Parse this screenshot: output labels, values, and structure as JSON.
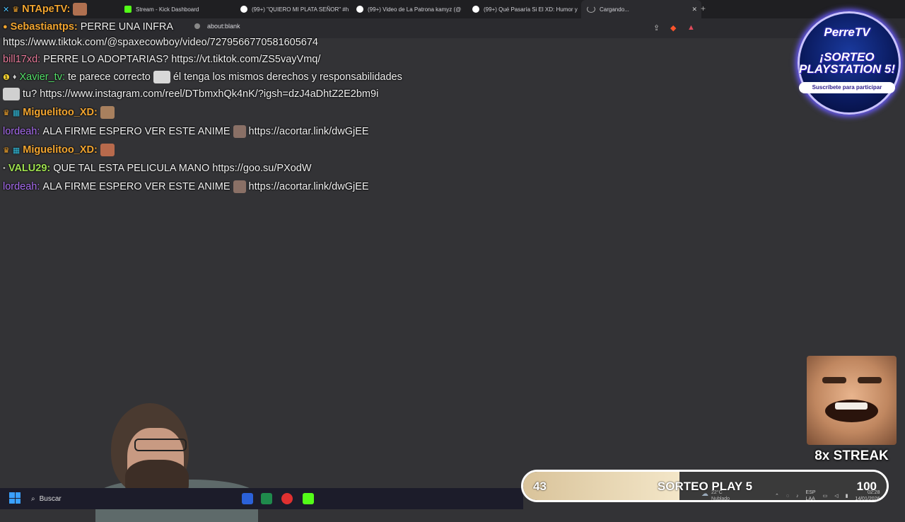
{
  "browser": {
    "tabs": [
      {
        "title": "Stream - Kick Dashboard",
        "color": "#53fc18"
      },
      {
        "title": "(99+) \"QUIERO MI PLATA SEÑOR\" #h",
        "color": "#ffffff"
      },
      {
        "title": "(99+) Video de La Patrona kamyz (@",
        "color": "#ffffff"
      },
      {
        "title": "(99+) Qué Pasaría Si El XD: Humor y",
        "color": "#ffffff"
      },
      {
        "title": "Cargando...",
        "color": "#9a9a9a"
      }
    ],
    "address": "about:blank"
  },
  "chat": {
    "messages": [
      {
        "user": "NTApeTV:",
        "text": ""
      },
      {
        "user": "Sebastiantps:",
        "text": "PERRE UNA INFRA"
      },
      {
        "user": "",
        "text": "https://www.tiktok.com/@spaxecowboy/video/7279566770581605674"
      },
      {
        "user": "bill17xd:",
        "text": "PERRE LO ADOPTARIAS? https://vt.tiktok.com/ZS5vayVmq/"
      },
      {
        "user": "Xavier_tv:",
        "text": "te parece correcto",
        "text2": "él tenga los mismos derechos y responsabilidades"
      },
      {
        "user": "",
        "text": "tu? https://www.instagram.com/reel/DTbmxhQk4nK/?igsh=dzJ4aDhtZ2E2bm9i"
      },
      {
        "user": "Miguelitoo_XD:",
        "text": ""
      },
      {
        "user": "lordeah:",
        "text": "ALA FIRME ESPERO VER ESTE ANIME",
        "text2": "https://acortar.link/dwGjEE"
      },
      {
        "user": "Miguelitoo_XD:",
        "text": ""
      },
      {
        "user": "VALU29:",
        "text": "QUE TAL ESTA PELICULA MANO https://goo.su/PXodW"
      },
      {
        "user": "lordeah:",
        "text": "ALA FIRME ESPERO VER ESTE ANIME",
        "text2": "https://acortar.link/dwGjEE"
      }
    ]
  },
  "logo": {
    "title": "PerreTV",
    "line1": "¡SORTEO",
    "line2": "PLAYSTATION 5!",
    "subtitle": "Suscríbete para participar"
  },
  "streak": {
    "label": "8x STREAK"
  },
  "goal": {
    "current": "43",
    "title": "SORTEO PLAY 5",
    "target": "100",
    "progress_fraction": 0.43
  },
  "taskbar": {
    "search_label": "Buscar",
    "lang": "ESP",
    "lang2": "LAA",
    "temp": "22°C",
    "weather": "Nublado",
    "time": "02:28",
    "date": "14/01/2026"
  }
}
